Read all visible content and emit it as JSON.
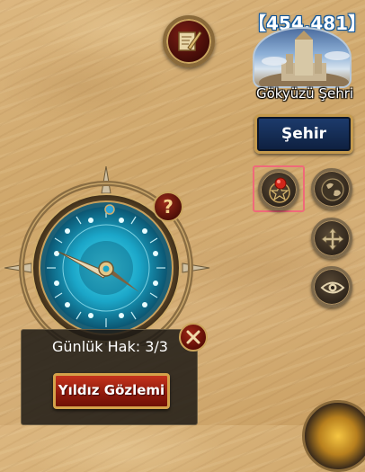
{
  "city": {
    "count_text": "【454,481】",
    "name": "Gökyüzü Şehri",
    "button_label": "Şehir"
  },
  "compass": {
    "help_symbol": "?"
  },
  "daily_panel": {
    "label": "Günlük Hak: 3/3",
    "observe_button": "Yıldız Gözlemi"
  },
  "icons": {
    "mission": "scroll-quill-icon",
    "star_observation": "star-globe-icon",
    "world_map": "globe-icon",
    "move": "arrows-move-icon",
    "view": "eye-icon",
    "close": "close-icon"
  },
  "colors": {
    "sand": "#d3ad74",
    "panel_bg": "#1e1b16",
    "button_red": "#b02a17",
    "highlight": "#f06a7a",
    "compass_blue": "#1ba6c8"
  }
}
